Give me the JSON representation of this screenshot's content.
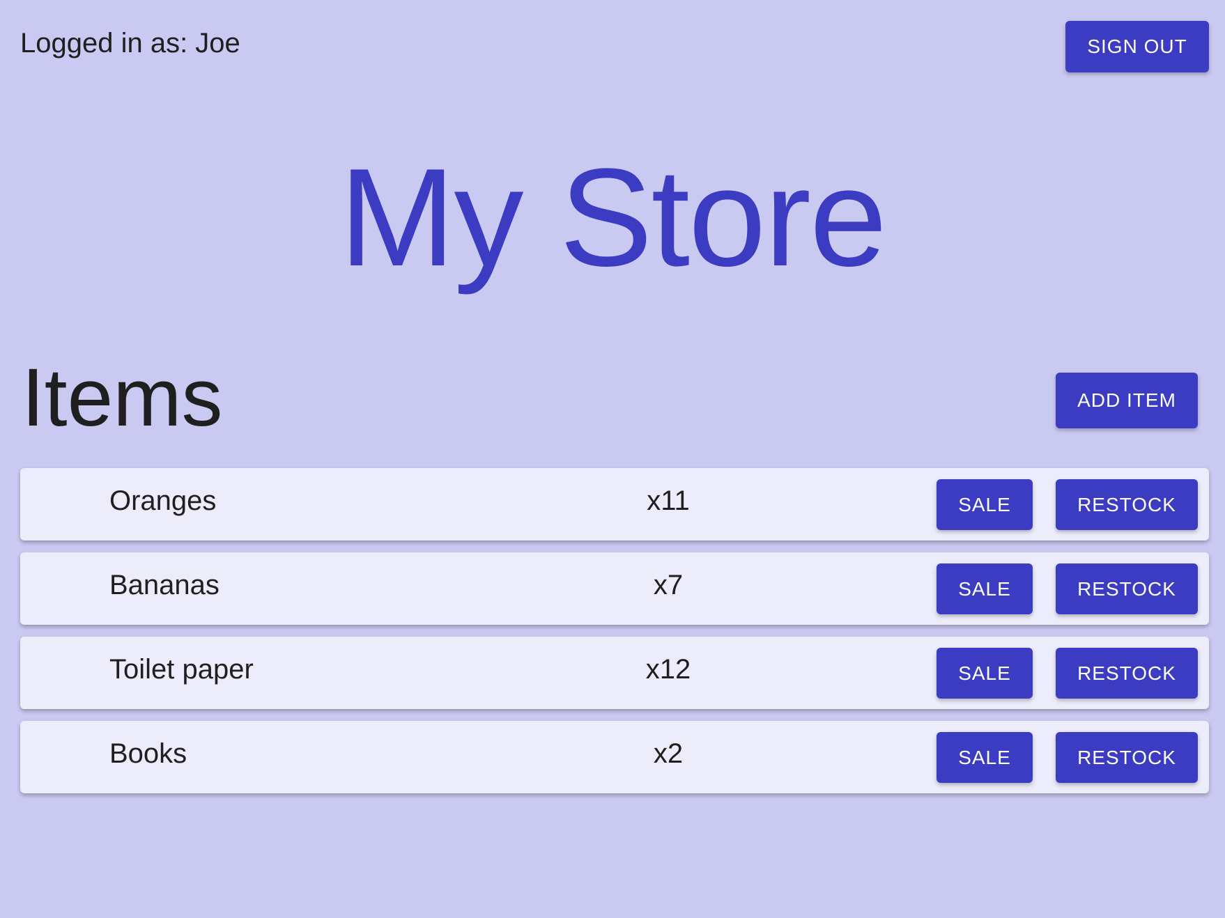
{
  "header": {
    "logged_in_text": "Logged in as: Joe",
    "sign_out_label": "SIGN OUT"
  },
  "store": {
    "title": "My Store"
  },
  "items_section": {
    "heading": "Items",
    "add_item_label": "ADD ITEM"
  },
  "items": [
    {
      "name": "Oranges",
      "quantity": "x11",
      "sale_label": "SALE",
      "restock_label": "RESTOCK"
    },
    {
      "name": "Bananas",
      "quantity": "x7",
      "sale_label": "SALE",
      "restock_label": "RESTOCK"
    },
    {
      "name": "Toilet paper",
      "quantity": "x12",
      "sale_label": "SALE",
      "restock_label": "RESTOCK"
    },
    {
      "name": "Books",
      "quantity": "x2",
      "sale_label": "SALE",
      "restock_label": "RESTOCK"
    }
  ],
  "colors": {
    "background": "#c9c9f2",
    "accent": "#3c3cc2",
    "card": "#ececfb"
  }
}
